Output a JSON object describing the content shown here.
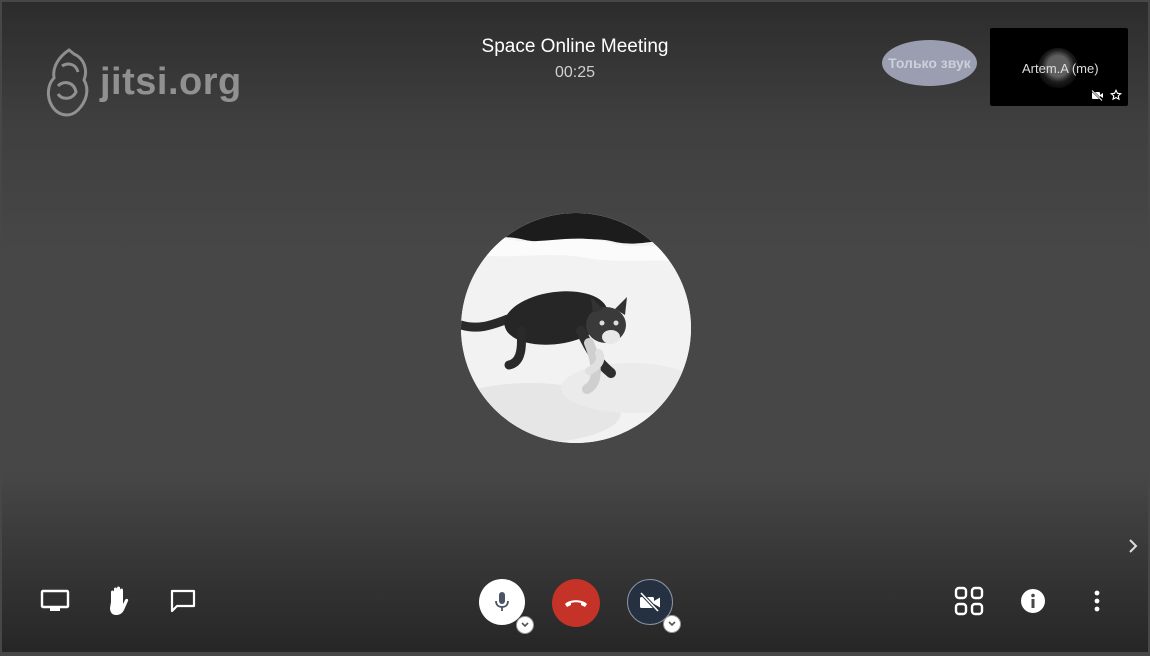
{
  "logo": {
    "text": "jitsi.org",
    "icon": "jitsi-logo-icon"
  },
  "meeting": {
    "title": "Space Online Meeting",
    "timer": "00:25"
  },
  "audio_only": {
    "label": "Только звук"
  },
  "self_view": {
    "name": "Artem.A (me)",
    "icons": [
      "video-off-icon",
      "star-icon"
    ]
  },
  "main_participant": {
    "avatar": "cat-in-snow-avatar"
  },
  "toolbar": {
    "left": [
      "screen-share-icon",
      "raise-hand-icon",
      "chat-icon"
    ],
    "center": [
      "microphone-icon",
      "hangup-icon",
      "video-off-icon"
    ],
    "right": [
      "tile-view-icon",
      "info-icon",
      "more-options-icon"
    ]
  },
  "colors": {
    "hangup": "#c53227",
    "video_muted": "#253141",
    "background": "#474747"
  }
}
